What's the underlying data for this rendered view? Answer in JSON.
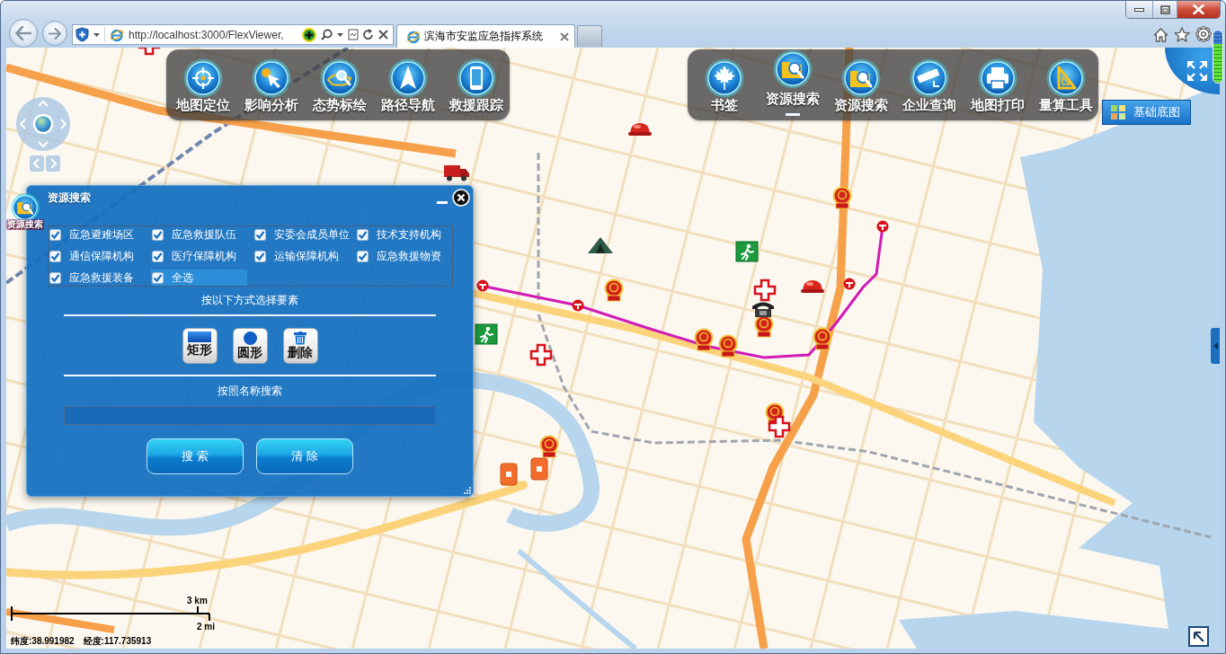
{
  "browser": {
    "address": {
      "url": "http://localhost:3000/FlexViewer,"
    },
    "tabs": [
      {
        "title": "滨海市安监应急指挥系统",
        "selected": true
      }
    ]
  },
  "toolbar_left": [
    {
      "label": "地图定位",
      "kind": "locate",
      "selected": false
    },
    {
      "label": "影响分析",
      "kind": "impact",
      "selected": false
    },
    {
      "label": "态势标绘",
      "kind": "plot",
      "selected": false
    },
    {
      "label": "路径导航",
      "kind": "navigate",
      "selected": false
    },
    {
      "label": "救援跟踪",
      "kind": "track",
      "selected": false
    }
  ],
  "toolbar_right": [
    {
      "label": "书签",
      "kind": "bookmark",
      "selected": false
    },
    {
      "label": "资源搜索",
      "kind": "resource",
      "selected": true
    },
    {
      "label": "资源搜索",
      "kind": "resource",
      "selected": false
    },
    {
      "label": "企业查询",
      "kind": "camera",
      "selected": false
    },
    {
      "label": "地图打印",
      "kind": "print",
      "selected": false
    },
    {
      "label": "量算工具",
      "kind": "measure",
      "selected": false
    }
  ],
  "basemap_button": {
    "label": "基础底图"
  },
  "zoom_slider": {
    "level": 0.74
  },
  "widget_badge": {
    "label": "资源搜索"
  },
  "dialog": {
    "title": "资源搜索",
    "categories": [
      {
        "label": "应急避难场区",
        "checked": true,
        "highlighted": false
      },
      {
        "label": "应急救援队伍",
        "checked": true,
        "highlighted": false
      },
      {
        "label": "安委会成员单位",
        "checked": true,
        "highlighted": false
      },
      {
        "label": "技术支持机构",
        "checked": true,
        "highlighted": false
      },
      {
        "label": "通信保障机构",
        "checked": true,
        "highlighted": false
      },
      {
        "label": "医疗保障机构",
        "checked": true,
        "highlighted": false
      },
      {
        "label": "运输保障机构",
        "checked": true,
        "highlighted": false
      },
      {
        "label": "应急救援物资",
        "checked": true,
        "highlighted": false
      },
      {
        "label": "应急救援装备",
        "checked": true,
        "highlighted": false
      },
      {
        "label": "全选",
        "checked": true,
        "highlighted": true
      }
    ],
    "select_hint": "按以下方式选择要素",
    "tools": [
      {
        "label": "矩形",
        "kind": "rectangle"
      },
      {
        "label": "圆形",
        "kind": "circle"
      },
      {
        "label": "删除",
        "kind": "delete"
      }
    ],
    "name_hint": "按照名称搜索",
    "buttons": [
      {
        "label": "搜 索"
      },
      {
        "label": "清 除"
      }
    ]
  },
  "scale_bar": {
    "metric": "3 km",
    "imperial": "2 mi"
  },
  "coordinates": [
    {
      "label": "纬度:38.991982"
    },
    {
      "label": "经度:117.735913"
    }
  ]
}
